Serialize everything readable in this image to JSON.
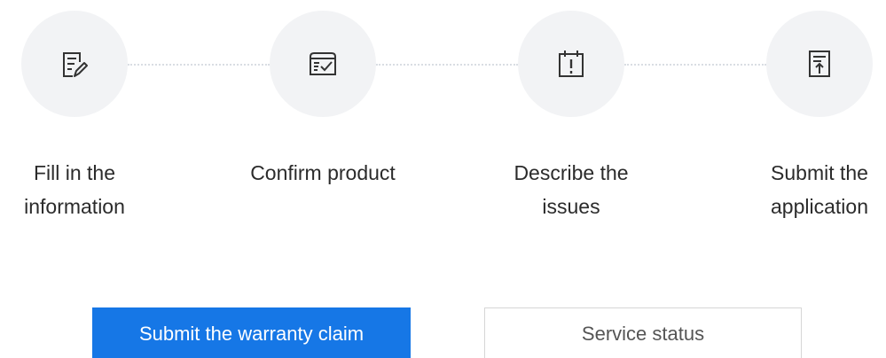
{
  "steps": [
    {
      "label": "Fill in the\ninformation",
      "icon": "form-edit-icon"
    },
    {
      "label": "Confirm product",
      "icon": "product-check-icon"
    },
    {
      "label": "Describe the\nissues",
      "icon": "calendar-alert-icon"
    },
    {
      "label": "Submit the\napplication",
      "icon": "document-upload-icon"
    }
  ],
  "actions": {
    "primary_label": "Submit the warranty claim",
    "secondary_label": "Service status"
  },
  "colors": {
    "primary": "#1677e6",
    "circle_bg": "#f2f3f5",
    "icon_stroke": "#333333",
    "connector": "#d9dde3"
  }
}
